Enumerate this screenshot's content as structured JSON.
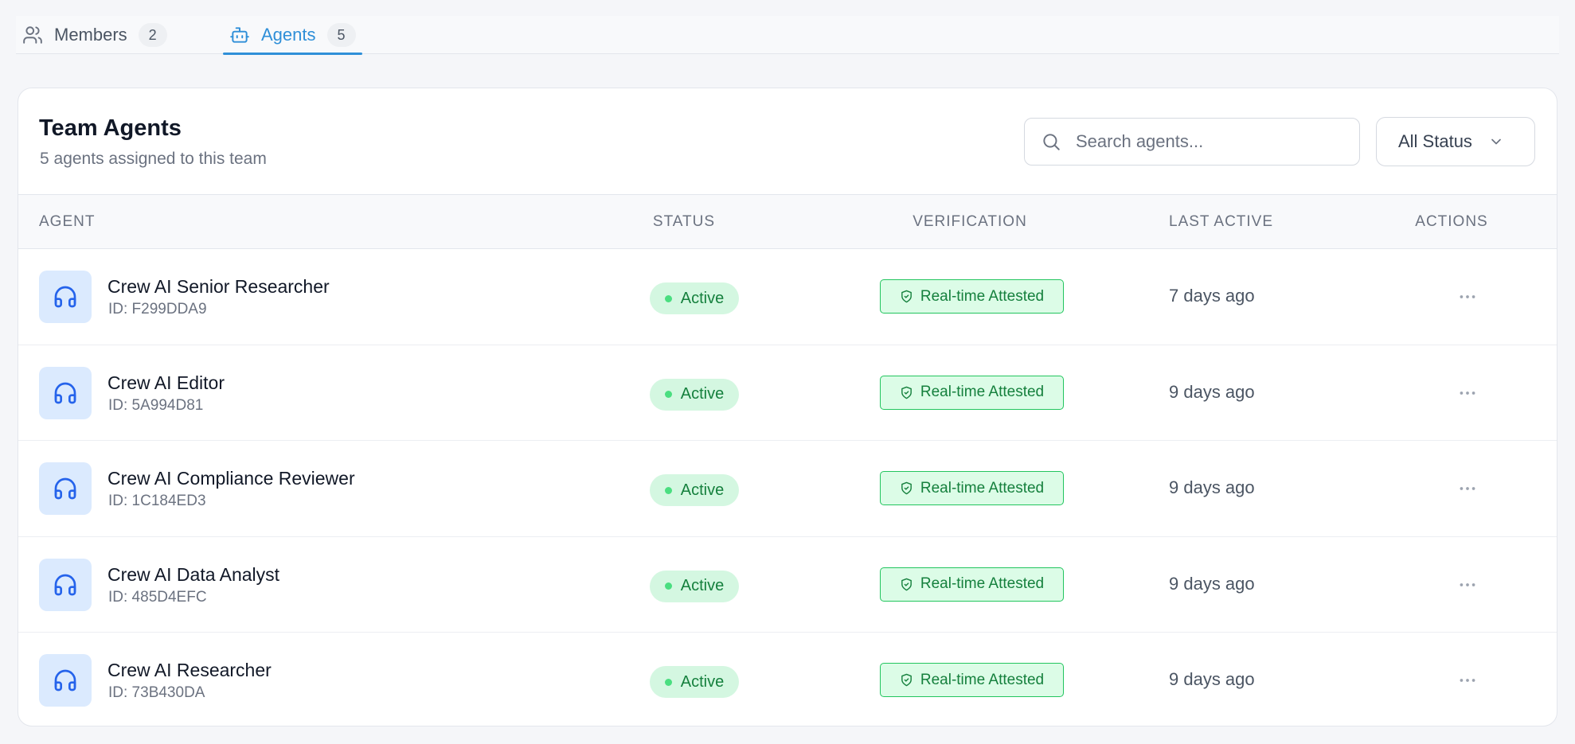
{
  "tabs": [
    {
      "label": "Members",
      "count": "2",
      "icon": "users-icon"
    },
    {
      "label": "Agents",
      "count": "5",
      "icon": "bot-icon"
    }
  ],
  "card": {
    "title": "Team Agents",
    "subtitle": "5 agents assigned to this team",
    "search_placeholder": "Search agents...",
    "status_filter": "All Status"
  },
  "table": {
    "headers": {
      "agent": "AGENT",
      "status": "STATUS",
      "verification": "VERIFICATION",
      "last_active": "LAST ACTIVE",
      "actions": "ACTIONS"
    },
    "rows": [
      {
        "name": "Crew AI Senior Researcher",
        "id": "ID: F299DDA9",
        "status": "Active",
        "verification": "Real-time Attested",
        "last_active": "7 days ago"
      },
      {
        "name": "Crew AI Editor",
        "id": "ID: 5A994D81",
        "status": "Active",
        "verification": "Real-time Attested",
        "last_active": "9 days ago"
      },
      {
        "name": "Crew AI Compliance Reviewer",
        "id": "ID: 1C184ED3",
        "status": "Active",
        "verification": "Real-time Attested",
        "last_active": "9 days ago"
      },
      {
        "name": "Crew AI Data Analyst",
        "id": "ID: 485D4EFC",
        "status": "Active",
        "verification": "Real-time Attested",
        "last_active": "9 days ago"
      },
      {
        "name": "Crew AI Researcher",
        "id": "ID: 73B430DA",
        "status": "Active",
        "verification": "Real-time Attested",
        "last_active": "9 days ago"
      }
    ]
  },
  "colors": {
    "accent": "#2f8fd8",
    "active_green": "#15803d",
    "active_bg": "#d4f7e1",
    "avatar_bg": "#dbeafe",
    "avatar_icon": "#2563eb"
  }
}
